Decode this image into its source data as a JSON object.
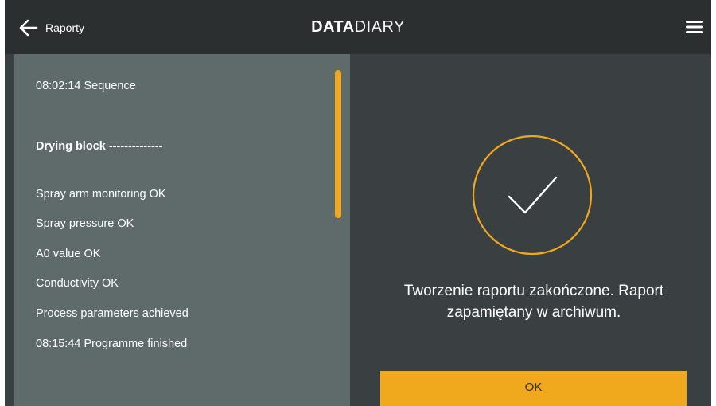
{
  "header": {
    "back_label": "Raporty",
    "logo_bold": "DATA",
    "logo_light": "DIARY"
  },
  "report_log": {
    "lines": [
      "08:02:14 Sequence",
      "Drying block --------------",
      "Spray arm monitoring OK",
      "Spray pressure OK",
      "A0 value OK",
      "Conductivity OK",
      "Process parameters achieved",
      "08:15:44 Programme finished"
    ]
  },
  "result": {
    "icon": "check-circle-icon",
    "message": "Tworzenie raportu zakończone. Raport zapamiętany w archiwum.",
    "ok_label": "OK"
  },
  "colors": {
    "accent": "#f0a81c",
    "topbar": "#2b2f30",
    "background": "#3a4041",
    "panel": "#5f6b6b"
  }
}
